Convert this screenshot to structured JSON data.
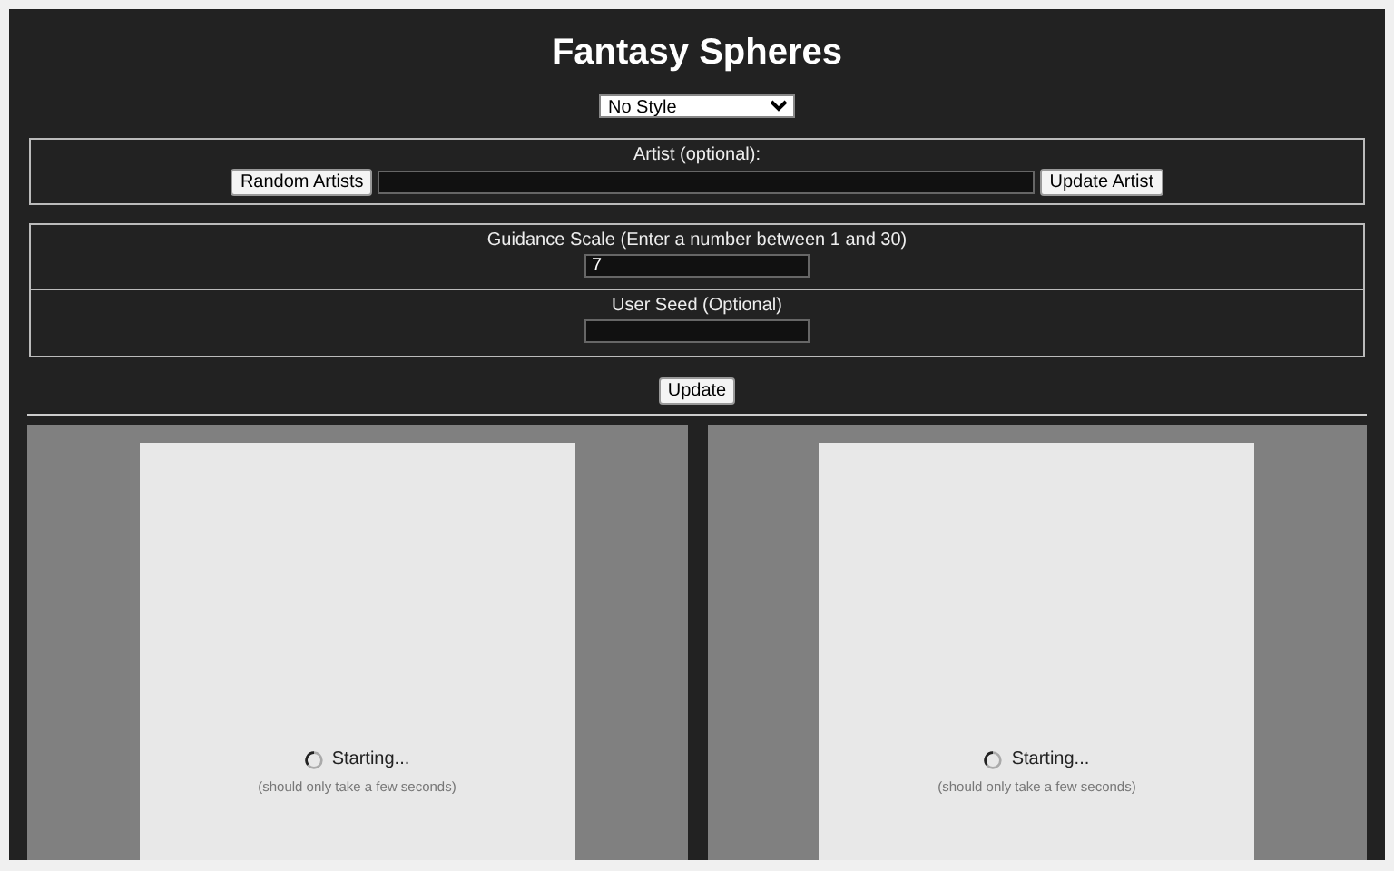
{
  "title": "Fantasy Spheres",
  "style_select": {
    "value": "No Style"
  },
  "artist": {
    "label": "Artist (optional):",
    "random_button": "Random Artists",
    "update_button": "Update Artist"
  },
  "guidance": {
    "label": "Guidance Scale (Enter a number between 1 and 30)",
    "value": "7"
  },
  "seed": {
    "label": "User Seed (Optional)"
  },
  "update_button": "Update",
  "panels": [
    {
      "status": "Starting...",
      "note": "(should only take a few seconds)"
    },
    {
      "status": "Starting...",
      "note": "(should only take a few seconds)"
    }
  ]
}
